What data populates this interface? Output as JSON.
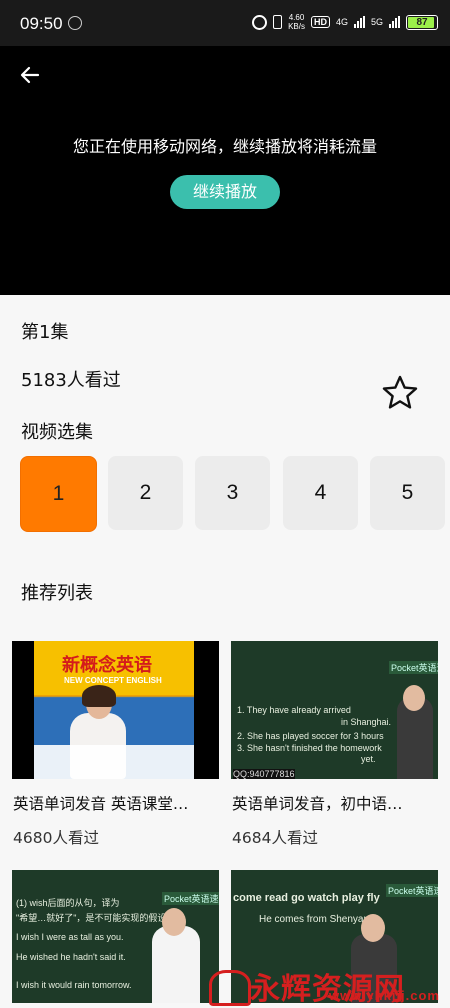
{
  "status_bar": {
    "time": "09:50",
    "net_speed_value": "4.60",
    "net_speed_unit": "KB/s",
    "hd_badge": "HD",
    "network_type_1": "4G",
    "network_type_2": "5G",
    "battery_percent": "87",
    "battery_color": "#9cf04a"
  },
  "player": {
    "network_warning": "您正在使用移动网络，继续播放将消耗流量",
    "continue_label": "继续播放",
    "accent_color": "#3bbfad"
  },
  "info": {
    "episode_title": "第1集",
    "view_count": "5183人看过",
    "favorite_icon": "star-outline-icon"
  },
  "episode_select": {
    "title": "视频选集",
    "items": [
      "1",
      "2",
      "3",
      "4",
      "5"
    ],
    "selected": "1",
    "selected_color": "#ff7a00"
  },
  "recommend": {
    "title": "推荐列表",
    "items": [
      {
        "title": "英语单词发音 英语课堂…",
        "views": "4680人看过",
        "thumb_text": "新概念英语",
        "thumb_sub": "NEW CONCEPT ENGLISH"
      },
      {
        "title": "英语单词发音，初中语…",
        "views": "4684人看过",
        "thumb_lines": [
          "1. They have already arrived",
          "in Shanghai.",
          "2. She has played soccer for 3 hours",
          "3. She hasn't finished the homework",
          "yet."
        ],
        "thumb_footer": "QQ:940777816",
        "thumb_badge": "Pocket英语速成"
      },
      {
        "thumb_lines": [
          "(1) wish后面的从句，译为",
          "\"希望…就好了\"，是不可能实现的假设。",
          "I wish I were as tall as you.",
          "He wished he hadn't said it.",
          "I wish it would rain tomorrow."
        ],
        "thumb_badge": "Pocket英语速成"
      },
      {
        "thumb_lines": [
          "come read go watch play fly",
          "He comes from Shenyang."
        ],
        "thumb_badge": "Pocket英语速成"
      }
    ]
  },
  "watermark": {
    "text": "永辉资源网",
    "url": "www.yhkjjj.com"
  }
}
